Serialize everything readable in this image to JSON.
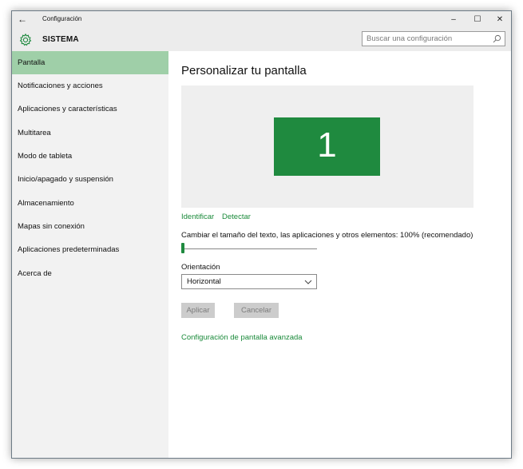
{
  "window": {
    "title": "Configuración",
    "back_symbol": "←",
    "controls": {
      "minimize": "–",
      "maximize": "☐",
      "close": "✕"
    }
  },
  "header": {
    "icon": "gear-icon",
    "title": "SISTEMA",
    "search_placeholder": "Buscar una configuración",
    "search_icon": "search-icon"
  },
  "sidebar": {
    "items": [
      {
        "label": "Pantalla",
        "active": true
      },
      {
        "label": "Notificaciones y acciones"
      },
      {
        "label": "Aplicaciones y características"
      },
      {
        "label": "Multitarea"
      },
      {
        "label": "Modo de tableta"
      },
      {
        "label": "Inicio/apagado y suspensión"
      },
      {
        "label": "Almacenamiento"
      },
      {
        "label": "Mapas sin conexión"
      },
      {
        "label": "Aplicaciones predeterminadas"
      },
      {
        "label": "Acerca de"
      }
    ]
  },
  "main": {
    "title": "Personalizar tu pantalla",
    "monitor_number": "1",
    "identify_link": "Identificar",
    "detect_link": "Detectar",
    "scale_label": "Cambiar el tamaño del texto, las aplicaciones y otros elementos: 100% (recomendado)",
    "scale_slider_level": 0,
    "orientation_label": "Orientación",
    "orientation_value": "Horizontal",
    "apply_button": "Aplicar",
    "cancel_button": "Cancelar",
    "advanced_link": "Configuración de pantalla avanzada"
  },
  "colors": {
    "accent": "#1f8a3f",
    "sidebar_active": "#9fcfa8",
    "link": "#1a8a3a"
  }
}
